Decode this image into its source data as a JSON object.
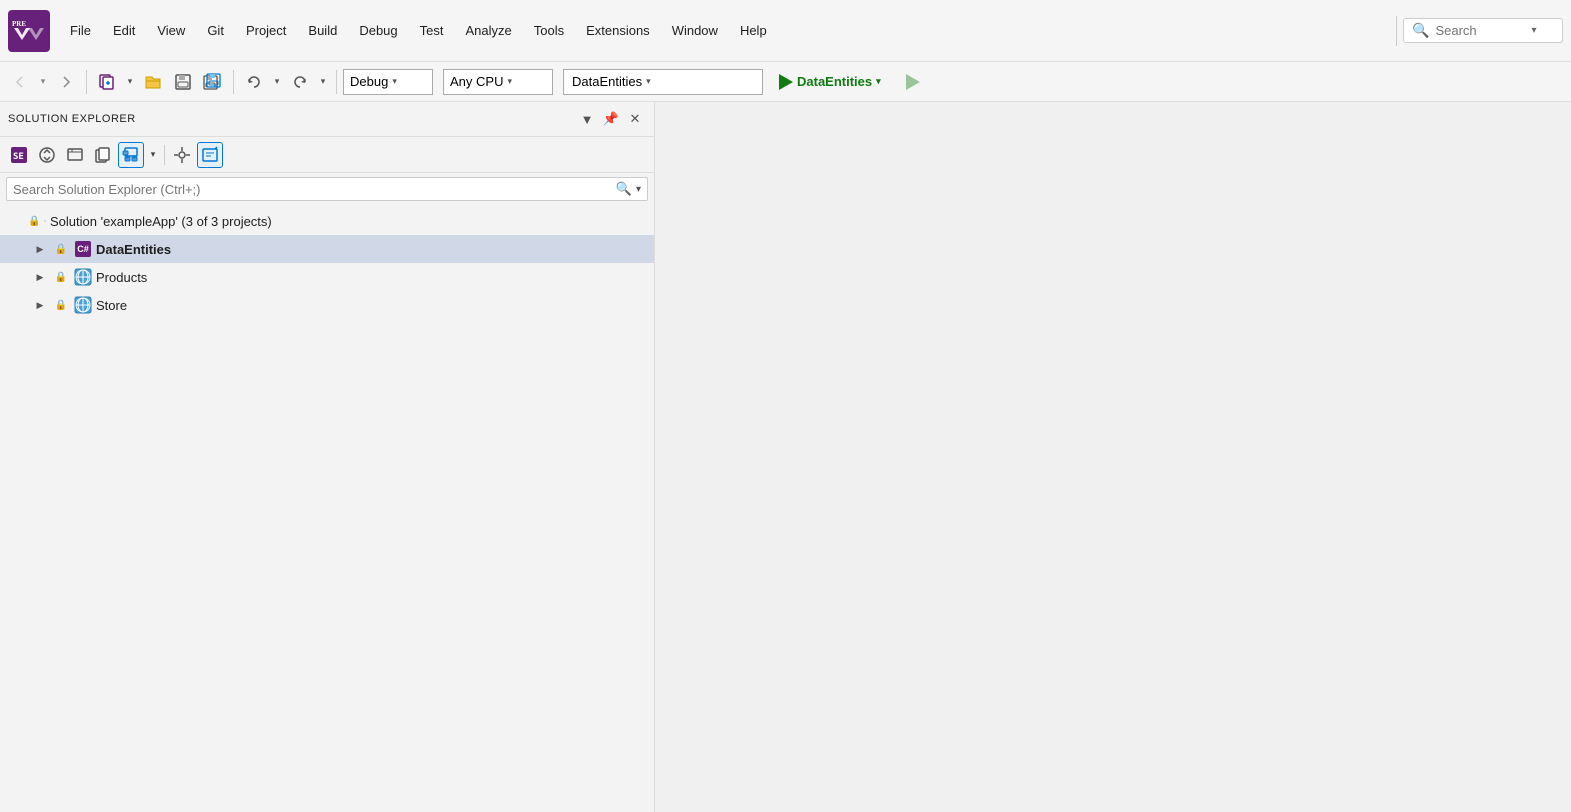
{
  "menubar": {
    "logo_alt": "Visual Studio PRE logo",
    "menu_items": [
      "File",
      "Edit",
      "View",
      "Git",
      "Project",
      "Build",
      "Debug",
      "Test",
      "Analyze",
      "Tools",
      "Extensions",
      "Window",
      "Help"
    ],
    "search_placeholder": "Search",
    "search_chevron": "▾"
  },
  "toolbar": {
    "config_options": [
      "Debug"
    ],
    "config_selected": "Debug",
    "platform_options": [
      "Any CPU"
    ],
    "platform_selected": "Any CPU",
    "startup_options": [
      "DataEntities"
    ],
    "startup_selected": "DataEntities",
    "run_label": "DataEntities"
  },
  "solution_explorer": {
    "title": "Solution Explorer",
    "search_placeholder": "Search Solution Explorer (Ctrl+;)",
    "solution_label": "Solution 'exampleApp' (3 of 3 projects)",
    "items": [
      {
        "id": "data-entities",
        "label": "DataEntities",
        "bold": true,
        "expanded": false,
        "indent": 1,
        "icon_type": "cs"
      },
      {
        "id": "products",
        "label": "Products",
        "bold": false,
        "expanded": false,
        "indent": 1,
        "icon_type": "globe"
      },
      {
        "id": "store",
        "label": "Store",
        "bold": false,
        "expanded": false,
        "indent": 1,
        "icon_type": "globe"
      }
    ]
  }
}
